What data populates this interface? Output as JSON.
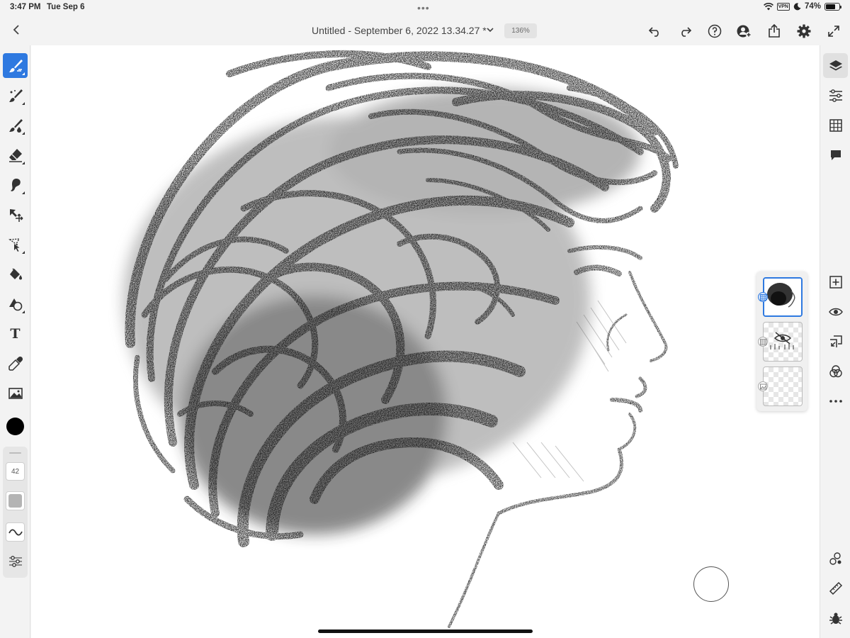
{
  "status_bar": {
    "time": "3:47 PM",
    "date": "Tue Sep 6",
    "vpn_label": "VPN",
    "battery_text": "74%",
    "battery_level": 0.74
  },
  "title_bar": {
    "document_title": "Untitled - September 6, 2022 13.34.27 *",
    "zoom_level": "136%",
    "buttons": [
      "back-icon",
      "title-menu-chevron",
      "undo-icon",
      "redo-icon",
      "help-icon",
      "share-user-icon",
      "export-icon",
      "settings-gear-icon",
      "fullscreen-icon"
    ]
  },
  "left_toolbar": {
    "tools": [
      {
        "name": "pixel-brush",
        "icon": "brush-pen-icon",
        "active": true
      },
      {
        "name": "live-brush",
        "icon": "brush-icon",
        "active": false
      },
      {
        "name": "vector-brush",
        "icon": "brush-drop-icon",
        "active": false
      },
      {
        "name": "eraser",
        "icon": "eraser-icon",
        "active": false
      },
      {
        "name": "smudge",
        "icon": "smudge-icon",
        "active": false
      },
      {
        "name": "transform",
        "icon": "move-arrows-icon",
        "active": false
      },
      {
        "name": "selection",
        "icon": "lasso-icon",
        "active": false
      },
      {
        "name": "fill",
        "icon": "paint-bucket-icon",
        "active": false
      },
      {
        "name": "shapes",
        "icon": "shapes-icon",
        "active": false
      },
      {
        "name": "text",
        "icon": "text-icon",
        "label": "T",
        "active": false
      },
      {
        "name": "eyedropper",
        "icon": "eyedropper-icon",
        "active": false
      },
      {
        "name": "place-image",
        "icon": "image-icon",
        "active": false
      }
    ],
    "current_color": "#000000",
    "brush_size": "42",
    "brush_opacity_level": 0.55
  },
  "right_toolbar": {
    "tools": [
      {
        "name": "layers",
        "icon": "layers-icon",
        "active": true
      },
      {
        "name": "layer-properties",
        "icon": "sliders-icon",
        "active": false
      },
      {
        "name": "grid",
        "icon": "grid-icon",
        "active": false
      },
      {
        "name": "comments",
        "icon": "comment-icon",
        "active": false
      },
      {
        "name": "add-layer",
        "icon": "add-layer-icon",
        "active": false
      },
      {
        "name": "visibility",
        "icon": "eye-icon",
        "active": false
      },
      {
        "name": "merge-down",
        "icon": "merge-icon",
        "active": false
      },
      {
        "name": "blend-mode",
        "icon": "blend-circles-icon",
        "active": false
      },
      {
        "name": "more",
        "icon": "more-dots-icon",
        "active": false
      },
      {
        "name": "layer-settings",
        "icon": "settings-cluster-icon",
        "active": false
      },
      {
        "name": "ruler",
        "icon": "ruler-icon",
        "active": false
      },
      {
        "name": "debug",
        "icon": "bug-icon",
        "active": false
      }
    ]
  },
  "layers": [
    {
      "name": "sketch-layer",
      "selected": true,
      "hidden": false,
      "badge_icon": "pixel-layer-icon"
    },
    {
      "name": "reference-layer",
      "selected": false,
      "hidden": true,
      "badge_icon": "pixel-layer-icon"
    },
    {
      "name": "image-layer",
      "selected": false,
      "hidden": false,
      "badge_icon": "image-layer-icon"
    }
  ],
  "colors": {
    "accent": "#2e79e0",
    "toolbar_bg": "#f3f3f3",
    "canvas_bg": "#ffffff"
  }
}
